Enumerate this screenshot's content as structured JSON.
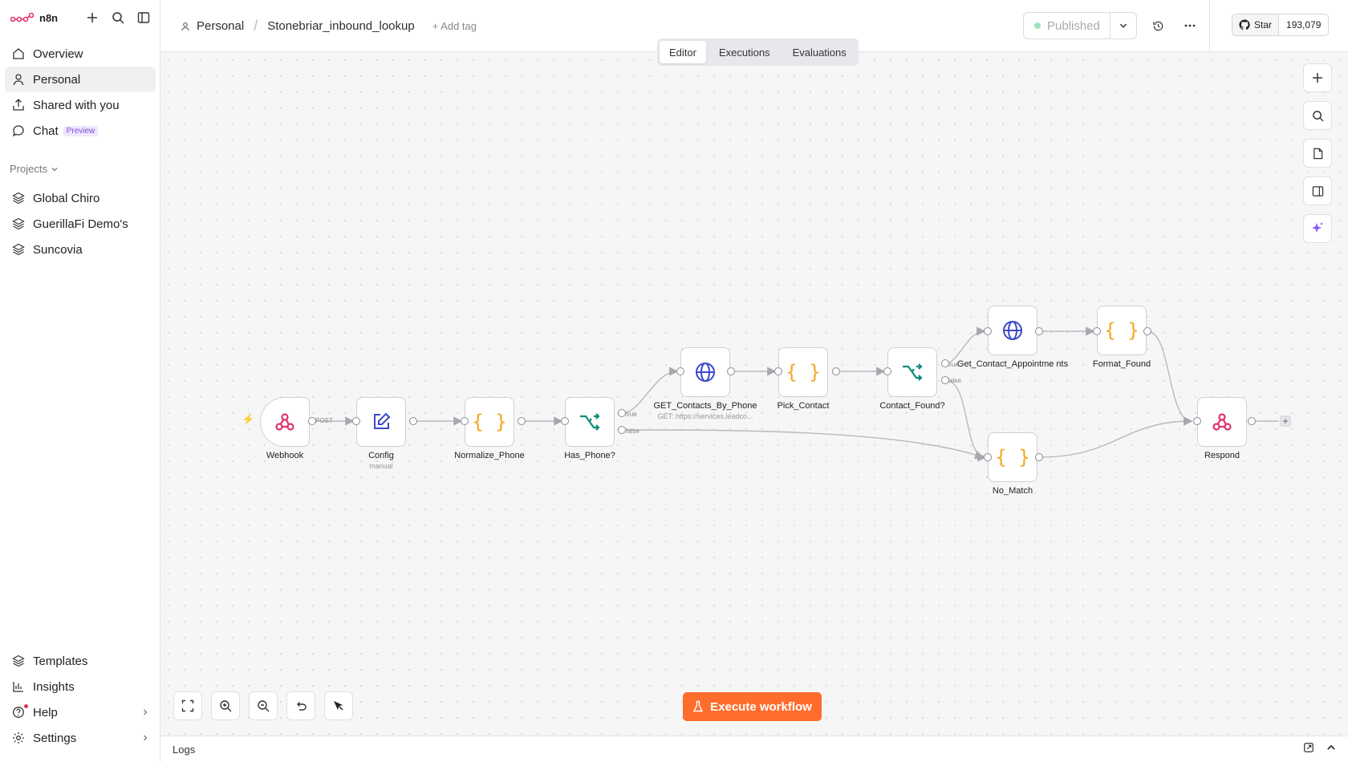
{
  "app": {
    "brand": "n8n"
  },
  "sidebar": {
    "nav": [
      {
        "label": "Overview",
        "icon": "home-icon"
      },
      {
        "label": "Personal",
        "icon": "user-icon"
      },
      {
        "label": "Shared with you",
        "icon": "share-icon"
      },
      {
        "label": "Chat",
        "icon": "chat-icon",
        "badge": "Preview"
      }
    ],
    "projects_label": "Projects",
    "projects": [
      {
        "label": "Global Chiro",
        "icon": "layers-icon"
      },
      {
        "label": "GuerillaFi Demo's",
        "icon": "layers-icon"
      },
      {
        "label": "Suncovia",
        "icon": "layers-icon"
      }
    ],
    "bottom": [
      {
        "label": "Templates",
        "icon": "templates-icon"
      },
      {
        "label": "Insights",
        "icon": "chart-icon"
      },
      {
        "label": "Help",
        "icon": "help-icon"
      },
      {
        "label": "Settings",
        "icon": "gear-icon"
      }
    ]
  },
  "header": {
    "breadcrumb_owner": "Personal",
    "workflow_name": "Stonebriar_inbound_lookup",
    "add_tag": "+ Add tag",
    "publish_label": "Published",
    "github_star": "Star",
    "github_count": "193,079"
  },
  "tabs": [
    "Editor",
    "Executions",
    "Evaluations"
  ],
  "nodes": [
    {
      "label": "Webhook",
      "type": "webhook"
    },
    {
      "label": "Config",
      "sub": "manual",
      "type": "edit"
    },
    {
      "label": "Normalize_Phone",
      "type": "code"
    },
    {
      "label": "Has_Phone?",
      "type": "if"
    },
    {
      "label": "GET_Contacts_By_Phone",
      "sub": "GET: https://services.leadco...",
      "type": "http"
    },
    {
      "label": "Pick_Contact",
      "type": "code"
    },
    {
      "label": "Contact_Found?",
      "type": "if"
    },
    {
      "label": "Get_Contact_Appointme nts",
      "type": "http"
    },
    {
      "label": "Format_Found",
      "type": "code"
    },
    {
      "label": "No_Match",
      "type": "code"
    },
    {
      "label": "Respond",
      "type": "webhook"
    }
  ],
  "edge_labels": {
    "post": "POST",
    "true": "true",
    "false": "false"
  },
  "execute_label": "Execute workflow",
  "logs_label": "Logs",
  "colors": {
    "accent": "#ff6d2d",
    "code": "#f5a623",
    "http": "#3b49c8",
    "if": "#0f8c7a",
    "webhook": "#e0326e"
  }
}
